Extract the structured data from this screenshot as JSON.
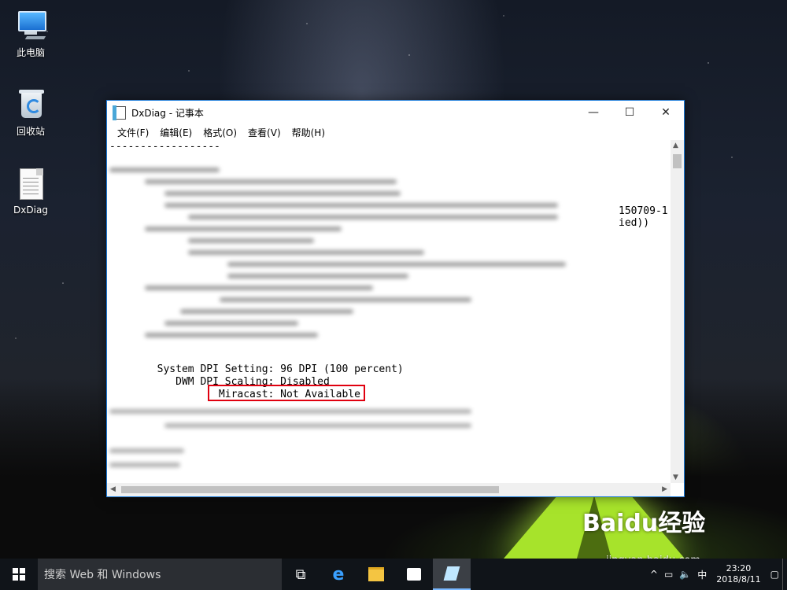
{
  "desktop": {
    "icons": [
      {
        "label": "此电脑"
      },
      {
        "label": "回收站"
      },
      {
        "label": "DxDiag"
      }
    ]
  },
  "window": {
    "title": "DxDiag - 记事本",
    "controls": {
      "minimize": "—",
      "maximize": "☐",
      "close": "✕"
    },
    "menu": [
      "文件(F)",
      "编辑(E)",
      "格式(O)",
      "查看(V)",
      "帮助(H)"
    ]
  },
  "editor": {
    "separator": "------------------",
    "right_fragment_1": "150709-1",
    "right_fragment_2": "ied))",
    "lines": [
      "  System DPI Setting: 96 DPI (100 percent)",
      "     DWM DPI Scaling: Disabled",
      "            Miracast: Not Available"
    ],
    "highlight_color": "#e0000f"
  },
  "taskbar": {
    "search_placeholder": "搜索 Web 和 Windows",
    "ime": "中",
    "time": "23:20",
    "date": "2018/8/11"
  },
  "watermark": {
    "brand": "Baidu经验",
    "url": "jingyan.baidu.com"
  }
}
